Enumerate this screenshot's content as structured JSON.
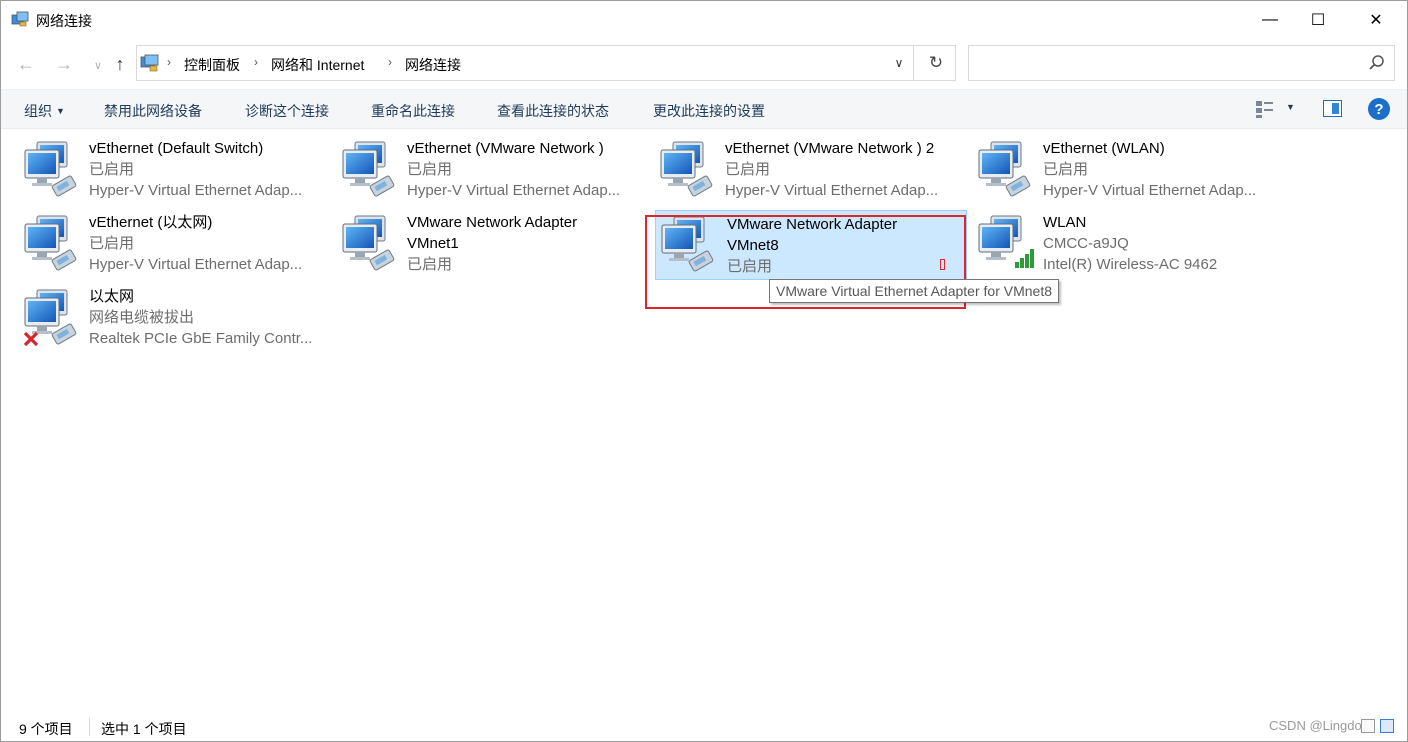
{
  "window": {
    "title": "网络连接",
    "minimize_glyph": "—",
    "maximize_glyph": "☐",
    "close_glyph": "✕"
  },
  "address": {
    "crumbs": [
      "控制面板",
      "网络和 Internet",
      "网络连接"
    ],
    "search_placeholder": ""
  },
  "commands": {
    "organize": "组织",
    "disable": "禁用此网络设备",
    "diagnose": "诊断这个连接",
    "rename": "重命名此连接",
    "view_status": "查看此连接的状态",
    "change_settings": "更改此连接的设置"
  },
  "items": [
    {
      "name": "vEthernet (Default Switch)",
      "line2": "已启用",
      "line3": "Hyper-V Virtual Ethernet Adap...",
      "icon": "network-adapter-icon"
    },
    {
      "name": "vEthernet (VMware Network )",
      "line2": "已启用",
      "line3": "Hyper-V Virtual Ethernet Adap...",
      "icon": "network-adapter-icon"
    },
    {
      "name": "vEthernet (VMware Network ) 2",
      "line2": "已启用",
      "line3": "Hyper-V Virtual Ethernet Adap...",
      "icon": "network-adapter-icon"
    },
    {
      "name": "vEthernet (WLAN)",
      "line2": "已启用",
      "line3": "Hyper-V Virtual Ethernet Adap...",
      "icon": "network-adapter-icon"
    },
    {
      "name": "vEthernet (以太网)",
      "line2": "已启用",
      "line3": "Hyper-V Virtual Ethernet Adap...",
      "icon": "network-adapter-icon"
    },
    {
      "name": "VMware Network Adapter",
      "line2": "VMnet1",
      "line3": "已启用",
      "icon": "network-adapter-icon"
    },
    {
      "name": "VMware Network Adapter",
      "line2": "VMnet8",
      "line3": "已启用",
      "icon": "network-adapter-icon",
      "selected": true
    },
    {
      "name": "WLAN",
      "line2": "CMCC-a9JQ",
      "line3": "Intel(R) Wireless-AC 9462",
      "icon": "wifi-signal-icon"
    },
    {
      "name": "以太网",
      "line2": "网络电缆被拔出",
      "line3": "Realtek PCIe GbE Family Contr...",
      "icon": "disconnected-x-icon"
    }
  ],
  "tooltip": "VMware Virtual Ethernet Adapter for VMnet8",
  "status": {
    "count": "9 个项目",
    "selected": "选中 1 个项目",
    "watermark": "CSDN @Lingdont"
  },
  "colors": {
    "selection_bg": "#cce8ff",
    "selection_border": "#99d1ff",
    "annotation_red": "#e0242d",
    "command_text": "#1e395b",
    "secondary_text": "#6d6d6d"
  }
}
